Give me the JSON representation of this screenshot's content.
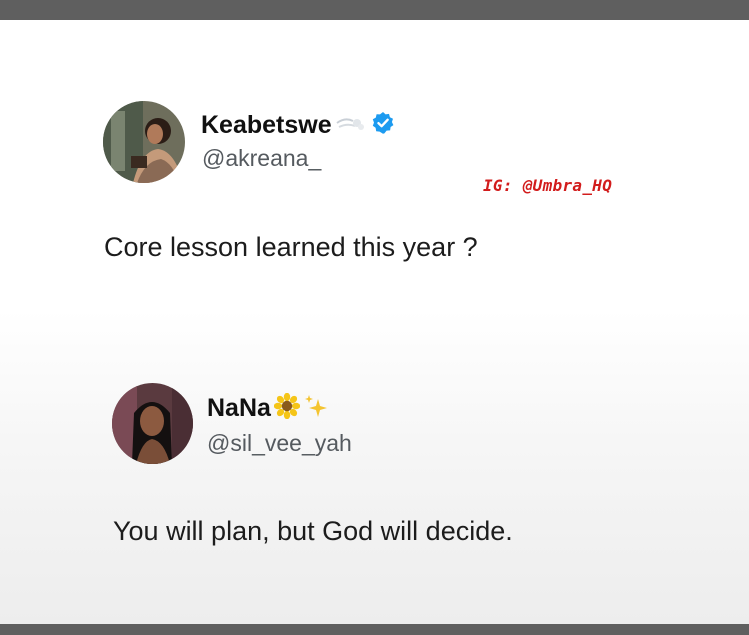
{
  "tweet1": {
    "display_name": "Keabetswe",
    "name_emoji": "dash-emoji",
    "verified_icon": "verified-badge-icon",
    "verified_color": "#1d9bf0",
    "handle": "@akreana_",
    "text": "Core lesson learned this year ?"
  },
  "watermark": "IG: @Umbra_HQ",
  "tweet2": {
    "display_name": "NaNa",
    "name_emoji_1": "sunflower-emoji",
    "name_emoji_2": "sparkles-emoji",
    "handle": "@sil_vee_yah",
    "text": "You will plan, but God will decide."
  }
}
